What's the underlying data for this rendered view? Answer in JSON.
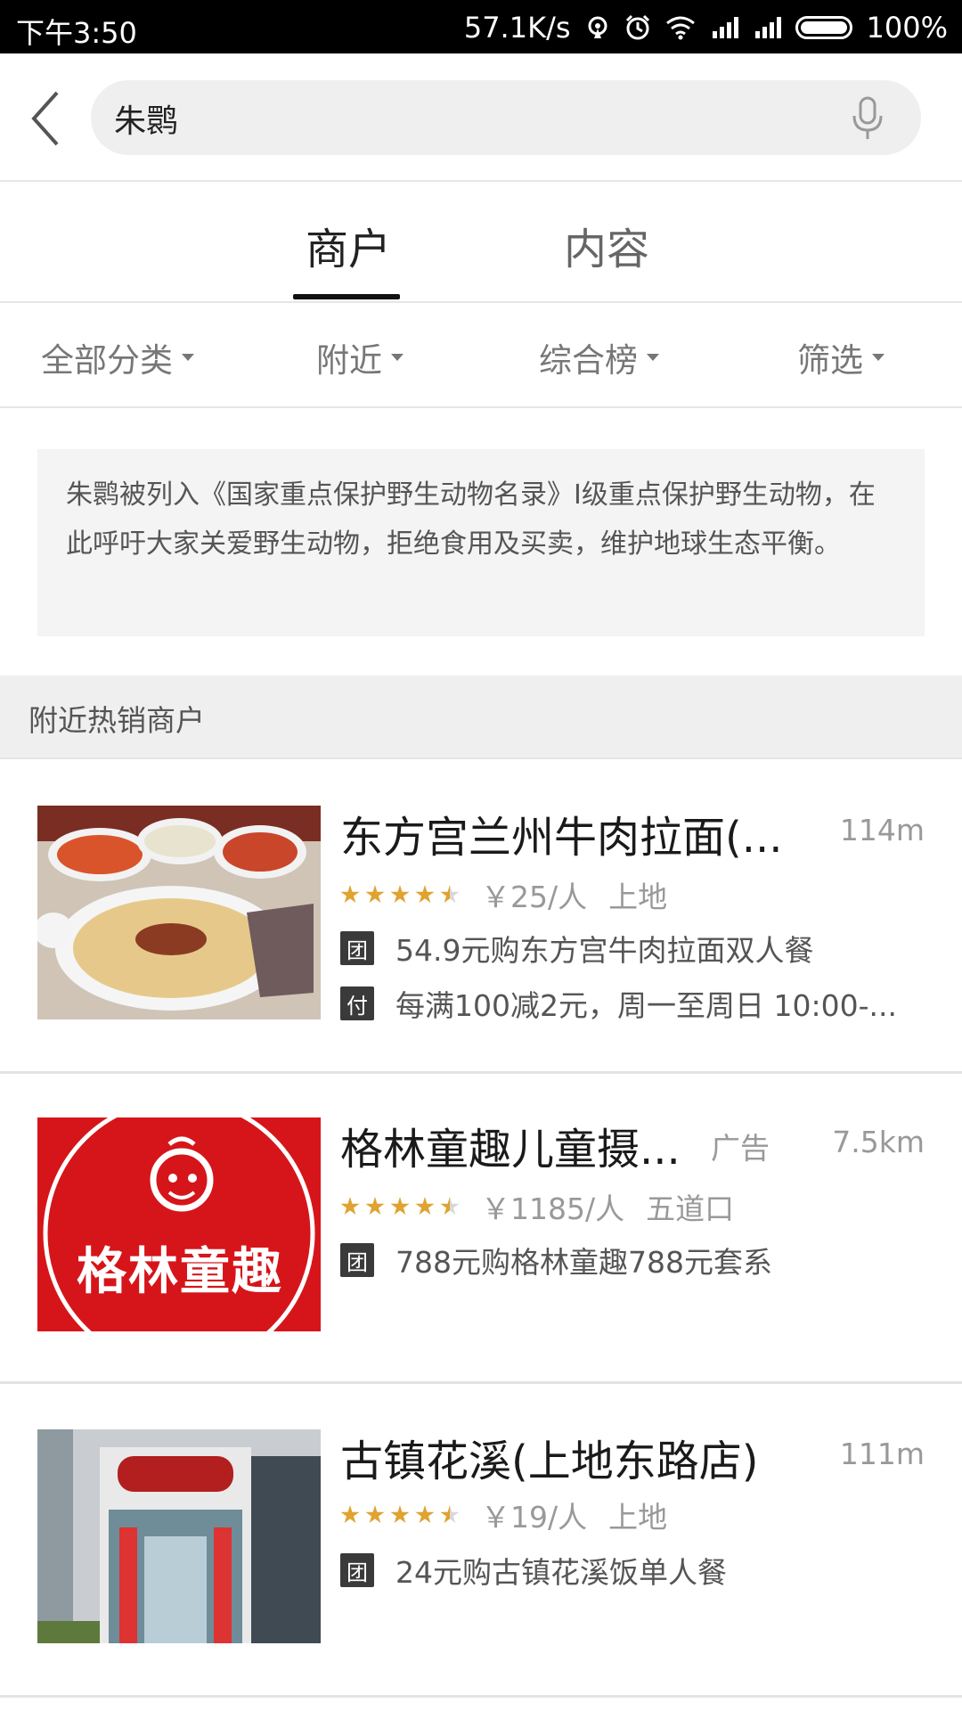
{
  "status_bar": {
    "time": "下午3:50",
    "net_speed": "57.1K/s",
    "battery": "100%"
  },
  "search": {
    "query": "朱鹮",
    "back_icon": "chevron-left-icon",
    "mic_icon": "microphone-icon"
  },
  "tabs": [
    {
      "label": "商户",
      "active": true
    },
    {
      "label": "内容",
      "active": false
    }
  ],
  "filters": [
    {
      "label": "全部分类"
    },
    {
      "label": "附近"
    },
    {
      "label": "综合榜"
    },
    {
      "label": "筛选"
    }
  ],
  "notice": "朱鹮被列入《国家重点保护野生动物名录》I级重点保护野生动物，在此呼吁大家关爱野生动物，拒绝食用及买卖，维护地球生态平衡。",
  "section_title": "附近热销商户",
  "colors": {
    "star": "#e0a330",
    "badge": "#3a3a3a",
    "divider": "#e6e6e6"
  },
  "merchants": [
    {
      "title": "东方宫兰州牛肉拉面(...",
      "distance": "114m",
      "ad_label": "",
      "rating": 4.5,
      "price": "￥25/人",
      "region": "上地",
      "promos": [
        {
          "badge": "团",
          "text": "54.9元购东方宫牛肉拉面双人餐"
        },
        {
          "badge": "付",
          "text": "每满100减2元，周一至周日 10:00-..."
        }
      ]
    },
    {
      "title": "格林童趣儿童摄...",
      "distance": "7.5km",
      "ad_label": "广告",
      "rating": 4.5,
      "price": "￥1185/人",
      "region": "五道口",
      "promos": [
        {
          "badge": "团",
          "text": "788元购格林童趣788元套系"
        }
      ],
      "logo_text": "格林童趣"
    },
    {
      "title": "古镇花溪(上地东路店)",
      "distance": "111m",
      "ad_label": "",
      "rating": 4.5,
      "price": "￥19/人",
      "region": "上地",
      "promos": [
        {
          "badge": "团",
          "text": "24元购古镇花溪饭单人餐"
        }
      ]
    }
  ]
}
